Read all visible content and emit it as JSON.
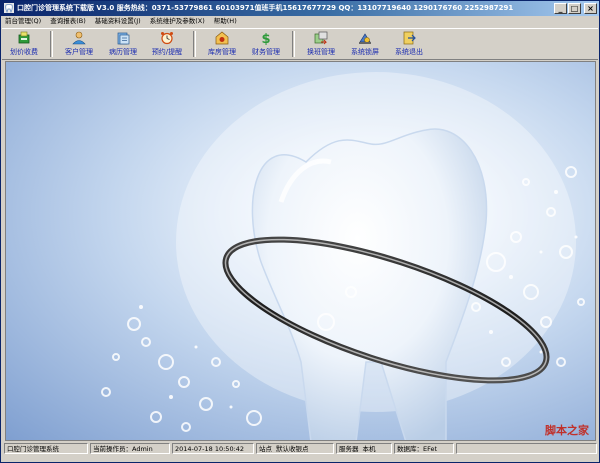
{
  "window": {
    "title": "口腔门诊管理系统下载版 V3.0    服务热线：0371-53779861 60103971值班手机15617677729    QQ：13107719640 1290176760 2252987291",
    "buttons": {
      "minimize": "_",
      "maximize": "□",
      "close": "×"
    }
  },
  "menu": [
    "前台管理(Q)",
    "查询报表(B)",
    "基础资料设置(J)",
    "系统维护及参数(X)",
    "帮助(H)"
  ],
  "toolbar": [
    {
      "label": "划价收费",
      "icon": "cashier-icon"
    },
    {
      "label": "客户管理",
      "icon": "customer-icon"
    },
    {
      "label": "病历管理",
      "icon": "medical-record-icon"
    },
    {
      "label": "预约/提醒",
      "icon": "alarm-clock-icon"
    },
    {
      "label": "库房管理",
      "icon": "warehouse-icon"
    },
    {
      "label": "财务管理",
      "icon": "dollar-icon"
    },
    {
      "label": "换班管理",
      "icon": "shift-change-icon"
    },
    {
      "label": "系统锁屏",
      "icon": "lock-screen-icon"
    },
    {
      "label": "系统退出",
      "icon": "exit-icon"
    }
  ],
  "status": {
    "app_name": "口腔门诊管理系统",
    "operator_label": "当前操作员：",
    "operator": "Admin",
    "datetime": "2014-07-18 10:50:42",
    "site_label": "站点",
    "site": "默认收银点",
    "server_label": "服务器",
    "server": "本机",
    "db_label": "数据库：",
    "db": "EFet"
  },
  "watermark": "脚本之家",
  "colors": {
    "title_bar": "#0a246a",
    "toolbar_label": "#1a2bb0",
    "watermark": "#c0302a"
  }
}
